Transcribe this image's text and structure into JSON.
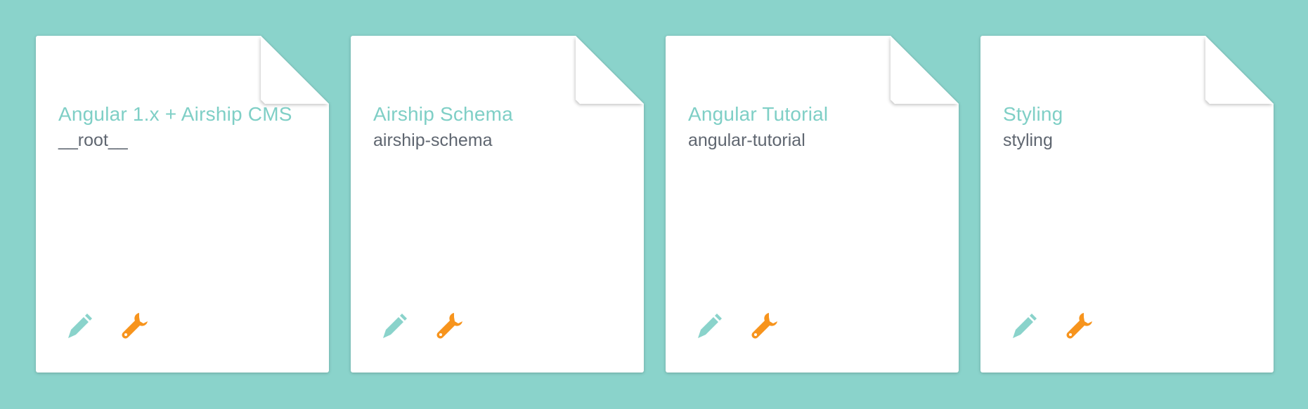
{
  "colors": {
    "background": "#8ad3cb",
    "card": "#ffffff",
    "title": "#7fcfc6",
    "slug": "#5f6670",
    "edit_icon": "#8ad3cb",
    "settings_icon": "#f7941d"
  },
  "projects": [
    {
      "title": "Angular 1.x + Airship CMS",
      "slug": "__root__",
      "edit_icon": "pencil-icon",
      "settings_icon": "wrench-icon"
    },
    {
      "title": "Airship Schema",
      "slug": "airship-schema",
      "edit_icon": "pencil-icon",
      "settings_icon": "wrench-icon"
    },
    {
      "title": "Angular Tutorial",
      "slug": "angular-tutorial",
      "edit_icon": "pencil-icon",
      "settings_icon": "wrench-icon"
    },
    {
      "title": "Styling",
      "slug": "styling",
      "edit_icon": "pencil-icon",
      "settings_icon": "wrench-icon"
    }
  ]
}
